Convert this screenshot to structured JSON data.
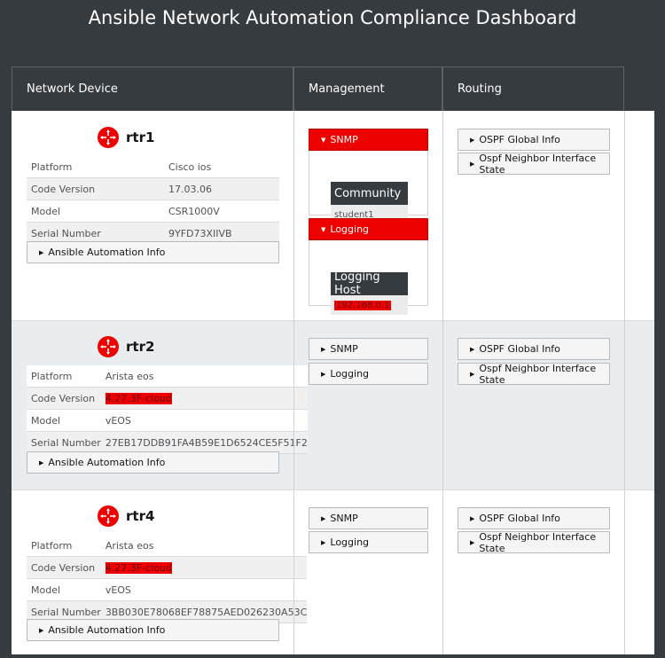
{
  "page": {
    "title": "Ansible Network Automation Compliance Dashboard"
  },
  "columns": [
    "Network Device",
    "Management",
    "Routing"
  ],
  "labels": {
    "platform": "Platform",
    "code_version": "Code Version",
    "model": "Model",
    "serial": "Serial Number",
    "ansible_info": "Ansible Automation Info",
    "snmp": "SNMP",
    "logging": "Logging",
    "community": "Community",
    "logging_host": "Logging Host",
    "ospf_global": "OSPF Global Info",
    "ospf_neighbor": "Ospf Neighbor Interface State"
  },
  "devices": [
    {
      "name": "rtr1",
      "platform": "Cisco ios",
      "code_version": "17.03.06",
      "model": "CSR1000V",
      "serial": "9YFD73XIIVB",
      "snmp_community": "student1",
      "logging_host": "192.168.0.1"
    },
    {
      "name": "rtr2",
      "platform": "Arista eos",
      "code_version": "4.27.3F-cloud",
      "model": "vEOS",
      "serial": "27EB17DDB91FA4B59E1D6524CE5F51F2"
    },
    {
      "name": "rtr4",
      "platform": "Arista eos",
      "code_version": "4.27.3F-cloud",
      "model": "vEOS",
      "serial": "3BB030E78068EF78875AED026230A53C"
    }
  ],
  "colors": {
    "accent_red": "#ee0000",
    "header_bg": "#363b40"
  },
  "icons": {
    "caret": "caret-right-icon",
    "caret_open": "caret-down-icon",
    "device": "router-icon"
  }
}
